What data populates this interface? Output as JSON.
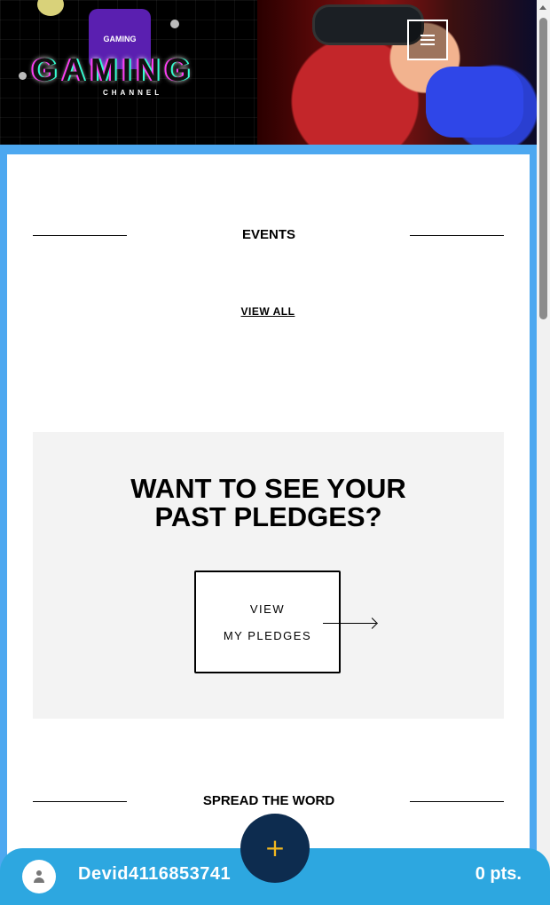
{
  "banner": {
    "logo_text": "GAMING",
    "brand_word": "GAMING",
    "brand_sub": "CHANNEL"
  },
  "header": {
    "menu_icon": "hamburger-icon"
  },
  "events": {
    "title": "EVENTS",
    "view_all_label": "VIEW ALL"
  },
  "pledges": {
    "heading_line1": "WANT TO SEE YOUR",
    "heading_line2": "PAST PLEDGES?",
    "button_line1": "VIEW",
    "button_line2": "MY PLEDGES",
    "arrow_icon": "arrow-right-icon"
  },
  "spread": {
    "title": "SPREAD THE WORD"
  },
  "footer": {
    "username": "Devid4116853741",
    "points": "0 pts.",
    "avatar_icon": "user-icon",
    "fab_label": "+",
    "fab_icon": "plus-icon",
    "colors": {
      "bar": "#2da7e0",
      "fab": "#0d2c4f",
      "fab_plus": "#f2b820"
    }
  },
  "colors": {
    "page_background": "#4da8f0",
    "pledge_panel": "#f3f3f3"
  }
}
